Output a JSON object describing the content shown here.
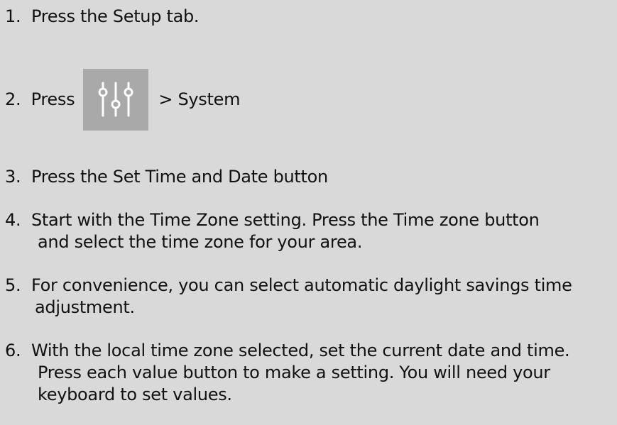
{
  "steps": [
    {
      "num": "1.",
      "lines": [
        "Press the Setup tab."
      ]
    },
    {
      "num": "2.",
      "before": "Press",
      "after": "> System",
      "icon": "settings-sliders-icon"
    },
    {
      "num": "3.",
      "lines": [
        "Press the Set Time and Date button"
      ]
    },
    {
      "num": "4.",
      "lines": [
        "Start with the Time Zone setting. Press the Time zone button",
        "and select the time zone for your area."
      ]
    },
    {
      "num": "5.",
      "lines": [
        "For convenience, you can select automatic daylight savings time",
        "adjustment."
      ]
    },
    {
      "num": "6.",
      "lines": [
        "With the local time zone selected, set the current date and time.",
        "Press each value button to make a setting. You will need your",
        "keyboard to set values."
      ]
    }
  ],
  "colors": {
    "background": "#d9d9d9",
    "icon_tile": "#a9a9a9",
    "icon_stroke": "#ffffff",
    "text": "#111111"
  }
}
